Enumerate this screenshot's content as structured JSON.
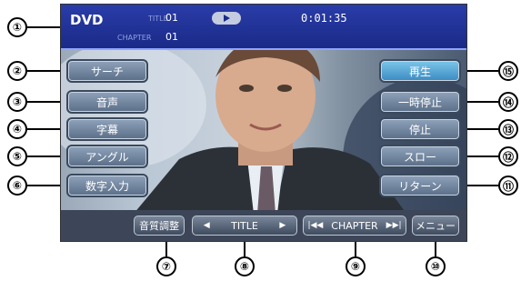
{
  "status": {
    "source": "DVD",
    "title_label": "TITLE",
    "title_value": "01",
    "chapter_label": "CHAPTER",
    "chapter_value": "01",
    "play_icon": "play-icon",
    "time": "0:01:35"
  },
  "left_buttons": [
    "サーチ",
    "音声",
    "字幕",
    "アングル",
    "数字入力"
  ],
  "right_buttons": [
    "再生",
    "一時停止",
    "停止",
    "スロー",
    "リターン"
  ],
  "bottom_buttons": {
    "sound": "音質調整",
    "title": "TITLE",
    "chapter": "CHAPTER",
    "menu": "メニュー"
  },
  "callouts": {
    "c1": "①",
    "c2": "②",
    "c3": "③",
    "c4": "④",
    "c5": "⑤",
    "c6": "⑥",
    "c7": "⑦",
    "c8": "⑧",
    "c9": "⑨",
    "c10": "⑩",
    "c11": "⑪",
    "c12": "⑫",
    "c13": "⑬",
    "c14": "⑭",
    "c15": "⑮"
  },
  "colors": {
    "status_bar": "#2a3ca8",
    "active_button": "#5aa8d8"
  }
}
